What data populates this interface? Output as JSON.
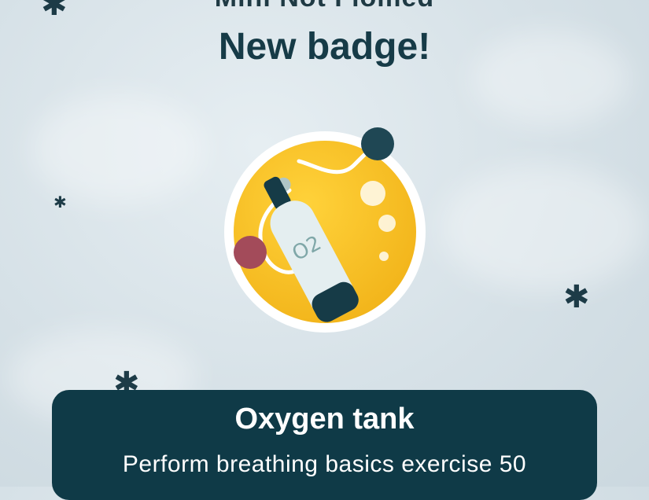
{
  "screen": {
    "top_clipped_text": "Mini Not Flomed",
    "title": "New badge!"
  },
  "badge": {
    "icon": "oxygen-tank-badge-icon",
    "tank_label": "O2",
    "colors": {
      "yellow": "#F6C21A",
      "ring": "#FFFFFF",
      "tank": "#E4EEF0",
      "cap": "#163B47",
      "maroon_dot": "#A34B5A",
      "teal_dot": "#1F4754"
    }
  },
  "card": {
    "title": "Oxygen tank",
    "description": "Perform breathing basics exercise 50"
  },
  "colors": {
    "title_text": "#163B47",
    "card_bg": "#0F3A47",
    "background": "#D6E1E7"
  }
}
